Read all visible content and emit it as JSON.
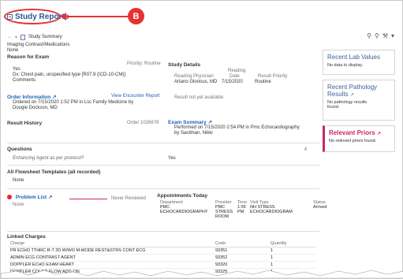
{
  "title": {
    "text": "Study Reports"
  },
  "callout": {
    "marker": "B"
  },
  "toolbar": {
    "nav_back": "←",
    "nav_dropdown": "▾",
    "doc_label": "Study Summary"
  },
  "contrast": {
    "label": "Imaging Contrast/Medications",
    "value": "None"
  },
  "reason": {
    "header": "Reason for Exam",
    "priority": "Priority: Routine",
    "yes": "Yes",
    "diagnosis": "Dx: Chest pain, unspecified type [R07.9 (ICD-10-CM)]",
    "comments": "Comments"
  },
  "order": {
    "header": "Order Information",
    "link": "View Encounter Report",
    "ordered_line1": "Ordered on 7/15/2020  1:52 PM in Lsc Family Medicine by",
    "ordered_line2": "Dougie Dockson, MD"
  },
  "result_history": {
    "header": "Result History",
    "order_number": "Order 1026878"
  },
  "study_details": {
    "header": "Study Details",
    "col_reading": "Reading Physician",
    "col_reading_date_top": "Reading",
    "col_reading_date": "Date",
    "col_priority": "Result Priority",
    "physician": "Artano Glorious, MD",
    "date": "7/15/2020",
    "priority": "Routine",
    "not_available": "Result not yet available"
  },
  "exam_summary": {
    "header": "Exam Summary",
    "line1": "Performed on 7/15/2020  2:54 PM in Pmc Echocardiography",
    "line2": "by Sardman, Nikki"
  },
  "questions": {
    "header": "Questions",
    "question": "Enhancing Agent as per protocol?",
    "answer": "Yes"
  },
  "flowsheet": {
    "header": "All Flowsheet Templates (all recorded)",
    "value": "None"
  },
  "problem_list": {
    "header": "Problem List",
    "reviewed": "Never Reviewed",
    "value": "None"
  },
  "appointments": {
    "header": "Appointments Today",
    "cols": [
      "Department",
      "Provider",
      "Time",
      "Visit Type",
      "Status"
    ],
    "row": {
      "department_1": "PMC",
      "department_2": "ECHOCARDIOGRAPHY",
      "provider_1": "PMC",
      "provider_2": "STRESS",
      "provider_3": "ROOM",
      "time_1": "1:55",
      "time_2": "PM",
      "visit_1": "NH STRESS",
      "visit_2": "ECHOCARDIOGRAM",
      "status": "Arrived"
    }
  },
  "linked_charges": {
    "header": "Linked Charges",
    "cols": [
      "Charge",
      "Code",
      "Quantity"
    ],
    "rows": [
      {
        "charge": "PR ECHO TTHRC R-T 2D W/WO M-MODE REST&STRS CONT ECG",
        "code": "93351",
        "qty": "1"
      },
      {
        "charge": "ADMIN ECG CONTRAST AGENT",
        "code": "93352",
        "qty": "1"
      },
      {
        "charge": "DOPPLER ECHO EXAM HEART",
        "code": "93320",
        "qty": "1"
      },
      {
        "charge": "DOPPLER COLOR FLOW ADD-ON",
        "code": "93325",
        "qty": "1"
      }
    ]
  },
  "side": {
    "lab_title": "Recent Lab Values",
    "lab_text": "No data to display.",
    "path_title_1": "Recent Pathology",
    "path_title_2": "Results",
    "path_text_1": "No pathology results",
    "path_text_2": "found.",
    "priors_title": "Relevant Priors",
    "priors_text": "No relevant priors found."
  },
  "colors": {
    "accent_red": "#e63232",
    "link_blue": "#1e62b8",
    "priors_magenta": "#c8286d"
  }
}
